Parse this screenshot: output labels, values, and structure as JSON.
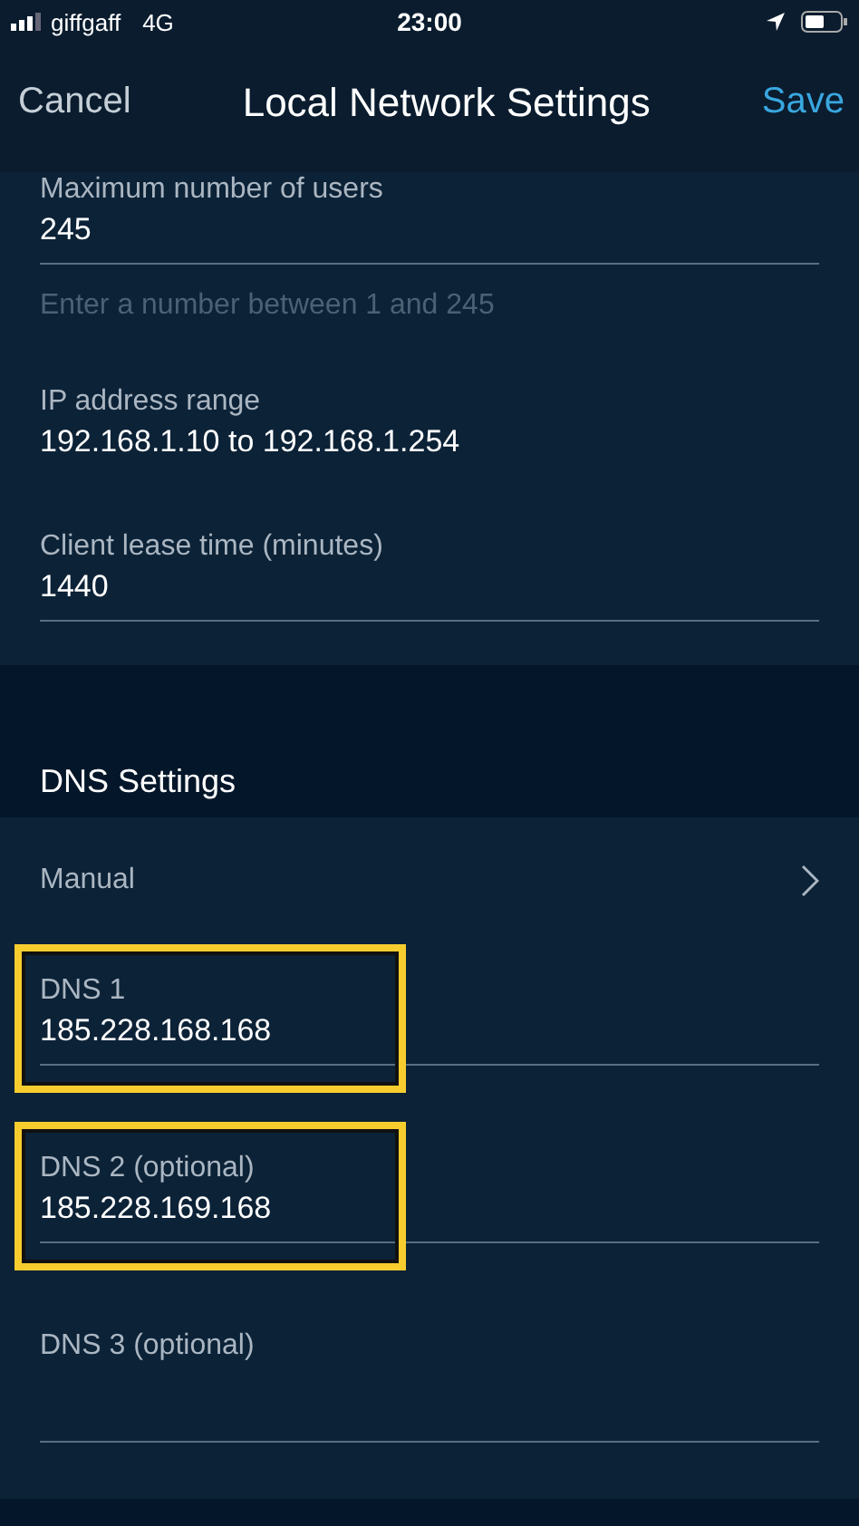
{
  "status_bar": {
    "carrier": "giffgaff",
    "network": "4G",
    "time": "23:00"
  },
  "nav": {
    "cancel": "Cancel",
    "title": "Local Network Settings",
    "save": "Save"
  },
  "dhcp_fields": [
    {
      "kind": "input",
      "label": "Maximum number of users",
      "value": "245",
      "hint": "Enter a number between 1 and 245"
    },
    {
      "kind": "text",
      "label": "IP address range",
      "value": "192.168.1.10 to 192.168.1.254"
    },
    {
      "kind": "input",
      "label": "Client lease time (minutes)",
      "value": "1440"
    }
  ],
  "dns": {
    "heading": "DNS Settings",
    "mode": "Manual",
    "fields": [
      {
        "label": "DNS 1",
        "value": "185.228.168.168",
        "highlighted": true
      },
      {
        "label": "DNS 2 (optional)",
        "value": "185.228.169.168",
        "highlighted": true
      },
      {
        "label": "DNS 3 (optional)",
        "highlighted": false
      }
    ]
  }
}
